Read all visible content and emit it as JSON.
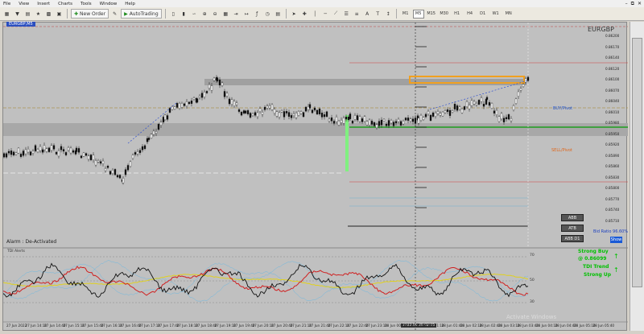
{
  "menu": [
    "File",
    "View",
    "Insert",
    "Charts",
    "Tools",
    "Window",
    "Help"
  ],
  "toolbar": {
    "new_order_label": "New Order",
    "autotrading_label": "AutoTrading",
    "timeframes": [
      "M1",
      "M5",
      "M15",
      "M30",
      "H1",
      "H4",
      "D1",
      "W1",
      "MN"
    ],
    "active_timeframe": "M5"
  },
  "chart": {
    "symbol": "EURGBP",
    "header_text": "EURGBP,M5",
    "alarm_text": "Alarm :  De-Activated",
    "buy_level_label": "BUY/Pivot",
    "sell_level_label": "SELL/Pivot",
    "bid_ratio_label": "Bid Ratio 96.60%",
    "show_button": "Show",
    "buttons": [
      "ABB",
      "ATB",
      "ABB D1"
    ]
  },
  "signals": {
    "line1": "Strong Buy",
    "line2": "@ 0.86099",
    "line3": "TDI Trend",
    "line4": "Strong Up"
  },
  "price_scale": [
    "0.86200",
    "0.86170",
    "0.86140",
    "0.86120",
    "0.86100",
    "0.86070",
    "0.86040",
    "0.86010",
    "0.85980",
    "0.85950",
    "0.85920",
    "0.85890",
    "0.85860",
    "0.85830",
    "0.85800",
    "0.85770",
    "0.85740",
    "0.85710"
  ],
  "indicator": {
    "title": "TDI Alerts",
    "levels": [
      "70",
      "50",
      "30"
    ]
  },
  "time_axis": [
    "27 Jun 2022",
    "27 Jun 14:10",
    "27 Jun 14:40",
    "27 Jun 15:10",
    "27 Jun 15:40",
    "27 Jun 16:10",
    "27 Jun 16:40",
    "27 Jun 17:10",
    "27 Jun 17:40",
    "27 Jun 18:10",
    "27 Jun 18:40",
    "27 Jun 19:10",
    "27 Jun 19:40",
    "27 Jun 20:10",
    "27 Jun 20:40",
    "27 Jun 21:10",
    "27 Jun 21:40",
    "27 Jun 22:10",
    "27 Jun 22:40",
    "27 Jun 23:10",
    "28 Jun 00:10",
    "28 Jun 00:40",
    "28 Jun 01:10",
    "28 Jun 01:40",
    "28 Jun 02:10",
    "28 Jun 02:40",
    "28 Jun 03:10",
    "28 Jun 03:40",
    "28 Jun 04:10",
    "28 Jun 04:40",
    "28 Jun 05:10",
    "28 Jun 05:40"
  ],
  "crosshair_time": "2022.06.28 02:15",
  "watermark": "Activate Windows",
  "colors": {
    "chart_bg": "#c0c0c0",
    "buy_green": "#1f9e1f",
    "sell_orange": "#e0661a",
    "signal_green": "#00c000",
    "highlight_orange": "#f0a020"
  }
}
